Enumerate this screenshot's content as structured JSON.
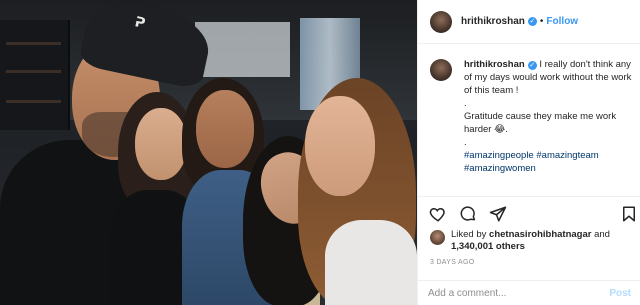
{
  "post": {
    "username": "hrithikroshan",
    "follow_label": "Follow",
    "separator": "•",
    "verified_glyph": "✓"
  },
  "caption": {
    "username": "hrithikroshan",
    "line1": "I really don't think any of my days would work without the work of this team !",
    "dot1": ".",
    "line2": "Gratitude cause they make me work harder 😂.",
    "dot2": ".",
    "hashtags": [
      "#amazingpeople",
      "#amazingteam",
      "#amazingwomen"
    ]
  },
  "likes": {
    "prefix": "Liked by",
    "liker": "chetnasirohibhatnagar",
    "connector": "and",
    "count": "1,340,001 others"
  },
  "time": "3 DAYS AGO",
  "comment": {
    "placeholder": "Add a comment...",
    "post_label": "Post"
  },
  "photo": {
    "cap_logo": "ᕈ",
    "description_icon": "group-selfie-photo"
  },
  "icons": {
    "like": "heart-icon",
    "comment": "comment-icon",
    "share": "share-icon",
    "save": "bookmark-icon"
  },
  "colors": {
    "link_blue": "#3897f0",
    "hashtag": "#00376b",
    "muted": "#8e8e8e",
    "text": "#262626",
    "post_disabled": "#b3dbff"
  }
}
